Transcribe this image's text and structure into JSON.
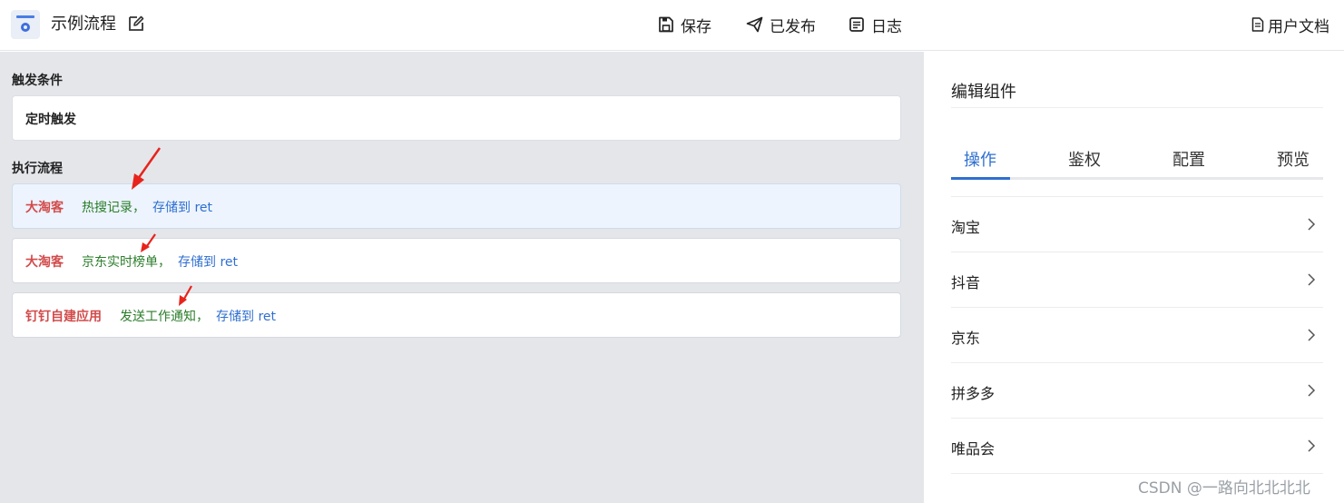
{
  "header": {
    "flow_title": "示例流程",
    "actions": {
      "save": "保存",
      "publish": "已发布",
      "log": "日志",
      "docs": "用户文档"
    }
  },
  "canvas": {
    "trigger_section_title": "触发条件",
    "trigger_label": "定时触发",
    "flow_section_title": "执行流程",
    "steps": [
      {
        "app": "大淘客",
        "operation": "热搜记录",
        "separator": "，",
        "store": "存储到 ret"
      },
      {
        "app": "大淘客",
        "operation": "京东实时榜单",
        "separator": "，",
        "store": "存储到 ret"
      },
      {
        "app": "钉钉自建应用",
        "operation": "发送工作通知",
        "separator": "，",
        "store": "存储到 ret"
      }
    ]
  },
  "panel": {
    "title": "编辑组件",
    "tabs": [
      "操作",
      "鉴权",
      "配置",
      "预览"
    ],
    "active_tab": "操作",
    "items": [
      "淘宝",
      "抖音",
      "京东",
      "拼多多",
      "唯品会"
    ]
  },
  "watermark": "CSDN @一路向北北北北",
  "colors": {
    "accent": "#2f6fd0",
    "app_name": "#d24b4b",
    "operation": "#2a7d2a",
    "arrow": "#e8231c"
  },
  "icons": {
    "logo": "app-logo-icon",
    "edit": "edit-icon",
    "save": "save-icon",
    "publish": "send-icon",
    "log": "log-icon",
    "docs": "document-icon",
    "item": "chevron-right-icon"
  }
}
